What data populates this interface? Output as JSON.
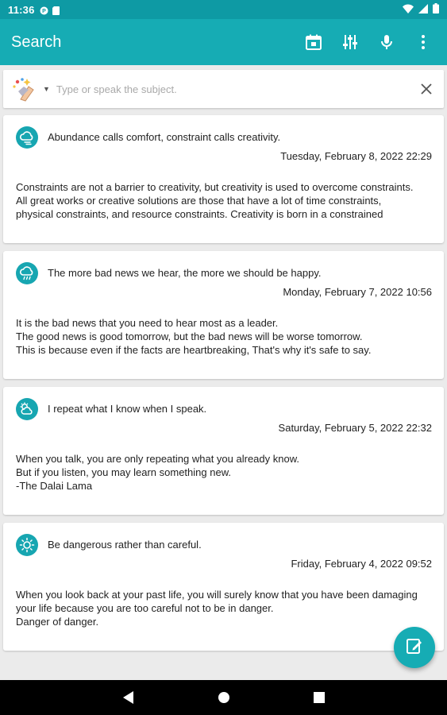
{
  "status_bar": {
    "time": "11:36"
  },
  "app_bar": {
    "title": "Search",
    "actions": [
      "calendar-icon",
      "tune-icon",
      "mic-icon",
      "more-vert-icon"
    ]
  },
  "search": {
    "placeholder": "Type or speak the subject.",
    "value": ""
  },
  "entries": [
    {
      "weather_icon": "cloud-wind-icon",
      "title": "Abundance calls comfort, constraint calls creativity.",
      "date": "Tuesday, February 8, 2022 22:29",
      "body": "Constraints are not a barrier to creativity, but creativity is used to overcome constraints.\nAll great works or creative solutions are those that have a lot of time constraints,\nphysical constraints, and resource constraints. Creativity is born in a constrained"
    },
    {
      "weather_icon": "cloud-rain-icon",
      "title": "The more bad news we hear, the more we should be happy.",
      "date": "Monday, February 7, 2022 10:56",
      "body": "It is the bad news that you need to hear most as a leader.\nThe good news is good tomorrow, but the bad news will be worse tomorrow.\nThis is because even if the facts are heartbreaking, That's why it's safe to say."
    },
    {
      "weather_icon": "partly-cloudy-icon",
      "title": "I repeat what I know when I speak.",
      "date": "Saturday, February 5, 2022 22:32",
      "body": "When you talk, you are only repeating what you already know.\nBut if you listen, you may learn something new.\n-The Dalai Lama"
    },
    {
      "weather_icon": "sun-icon",
      "title": "Be dangerous rather than careful.",
      "date": "Friday, February 4, 2022 09:52",
      "body": "When you look back at your past life, you will surely know that you have been damaging\nyour life because you are too careful not to be in danger.\nDanger of danger."
    }
  ],
  "colors": {
    "primary": "#16acb4",
    "primary_dark": "#0e9aa4",
    "icon_bg": "#17a6b1"
  }
}
